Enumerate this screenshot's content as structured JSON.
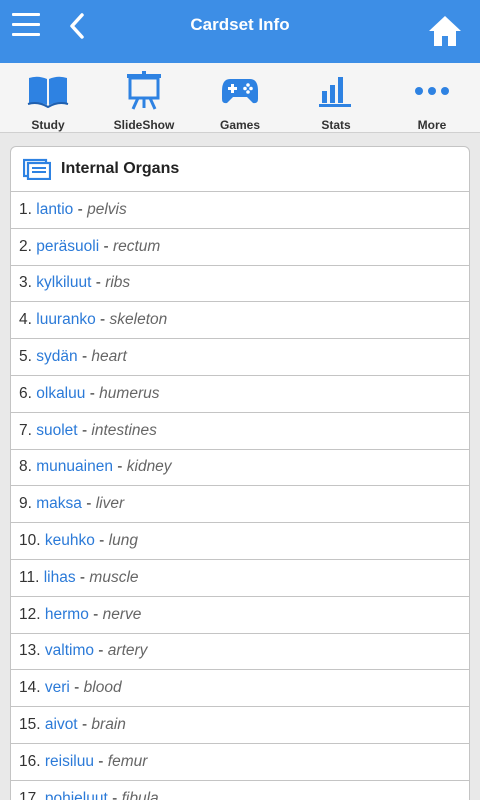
{
  "header": {
    "title": "Cardset Info"
  },
  "colors": {
    "accent": "#3d8ee6",
    "link": "#2b7ad8",
    "icon": "#2e82e2"
  },
  "toolbar": {
    "study": "Study",
    "slideshow": "SlideShow",
    "games": "Games",
    "stats": "Stats",
    "more": "More"
  },
  "cardset": {
    "title": "Internal Organs",
    "items": [
      {
        "num": "1.",
        "term": "lantio",
        "sep": "-",
        "def": "pelvis"
      },
      {
        "num": "2.",
        "term": "peräsuoli",
        "sep": "-",
        "def": "rectum"
      },
      {
        "num": "3.",
        "term": "kylkiluut",
        "sep": "-",
        "def": "ribs"
      },
      {
        "num": "4.",
        "term": "luuranko",
        "sep": "-",
        "def": "skeleton"
      },
      {
        "num": "5.",
        "term": "sydän",
        "sep": "-",
        "def": "heart"
      },
      {
        "num": "6.",
        "term": "olkaluu",
        "sep": "-",
        "def": "humerus"
      },
      {
        "num": "7.",
        "term": "suolet",
        "sep": "-",
        "def": "intestines"
      },
      {
        "num": "8.",
        "term": "munuainen",
        "sep": "-",
        "def": "kidney"
      },
      {
        "num": "9.",
        "term": "maksa",
        "sep": "-",
        "def": "liver"
      },
      {
        "num": "10.",
        "term": "keuhko",
        "sep": "-",
        "def": "lung"
      },
      {
        "num": "11.",
        "term": "lihas",
        "sep": "-",
        "def": "muscle"
      },
      {
        "num": "12.",
        "term": "hermo",
        "sep": "-",
        "def": "nerve"
      },
      {
        "num": "13.",
        "term": "valtimo",
        "sep": "-",
        "def": "artery"
      },
      {
        "num": "14.",
        "term": "veri",
        "sep": "-",
        "def": "blood"
      },
      {
        "num": "15.",
        "term": "aivot",
        "sep": "-",
        "def": "brain"
      },
      {
        "num": "16.",
        "term": "reisiluu",
        "sep": "-",
        "def": "femur"
      },
      {
        "num": "17.",
        "term": "pohjeluut",
        "sep": "-",
        "def": "fibula"
      }
    ]
  }
}
